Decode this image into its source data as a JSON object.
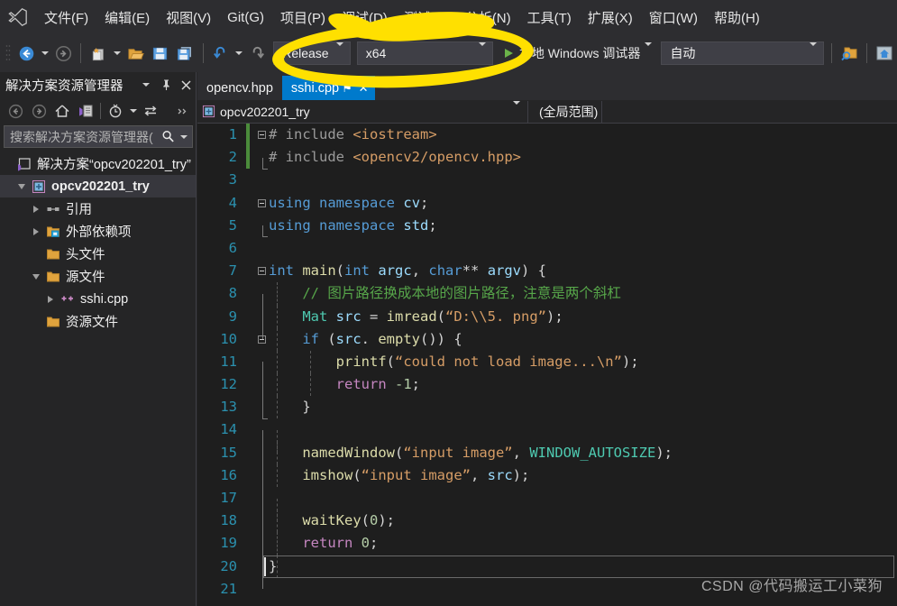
{
  "app": {
    "logo_icon": "visual-studio-logo-icon"
  },
  "menubar": {
    "items": [
      {
        "label": "文件(F)"
      },
      {
        "label": "编辑(E)"
      },
      {
        "label": "视图(V)"
      },
      {
        "label": "Git(G)"
      },
      {
        "label": "项目(P)"
      },
      {
        "label": "调试(D)"
      },
      {
        "label": "测试(S)"
      },
      {
        "label": "分析(N)"
      },
      {
        "label": "工具(T)"
      },
      {
        "label": "扩展(X)"
      },
      {
        "label": "窗口(W)"
      },
      {
        "label": "帮助(H)"
      }
    ]
  },
  "toolbar": {
    "back_icon": "navigate-back-icon",
    "forward_icon": "navigate-forward-icon",
    "new_item_icon": "new-item-icon",
    "open_file_icon": "open-file-icon",
    "save_icon": "save-icon",
    "save_all_icon": "save-all-icon",
    "undo_icon": "undo-icon",
    "redo_icon": "redo-icon",
    "configuration": "Release",
    "platform": "x64",
    "debug_target": "本地 Windows 调试器",
    "debug_target_icon": "run-play-icon",
    "auto_select": "自动",
    "find_in_files_icon": "find-in-files-icon",
    "home_icon": "home-window-icon"
  },
  "solution_explorer": {
    "title": "解决方案资源管理器",
    "menu_icon": "chevron-down-icon",
    "pin_icon": "pin-icon",
    "close_icon": "close-icon",
    "toolbar_icons": [
      "back-icon",
      "forward-icon",
      "home-icon",
      "switch-views-icon",
      "pending-changes-icon",
      "sync-with-active-document-icon",
      "expand-overflow-icon"
    ],
    "search": {
      "placeholder": "搜索解决方案资源管理器(",
      "value": "",
      "search_icon": "search-icon",
      "dropdown_icon": "chevron-down-icon"
    },
    "tree": [
      {
        "label": "解决方案“opcv202201_try”",
        "icon": "solution-icon",
        "depth": 0,
        "expander": "none",
        "bold": false,
        "selected": false
      },
      {
        "label": "opcv202201_try",
        "icon": "cpp-project-icon",
        "depth": 1,
        "expander": "down",
        "bold": true,
        "selected": true
      },
      {
        "label": "引用",
        "icon": "references-icon",
        "depth": 2,
        "expander": "right",
        "bold": false,
        "selected": false
      },
      {
        "label": "外部依赖项",
        "icon": "external-dependencies-icon",
        "depth": 2,
        "expander": "right",
        "bold": false,
        "selected": false
      },
      {
        "label": "头文件",
        "icon": "folder-filter-icon",
        "depth": 2,
        "expander": "none",
        "bold": false,
        "selected": false
      },
      {
        "label": "源文件",
        "icon": "folder-filter-icon",
        "depth": 2,
        "expander": "down",
        "bold": false,
        "selected": false
      },
      {
        "label": "sshi.cpp",
        "icon": "cpp-file-icon",
        "depth": 3,
        "expander": "right",
        "bold": false,
        "selected": false
      },
      {
        "label": "资源文件",
        "icon": "folder-filter-icon",
        "depth": 2,
        "expander": "none",
        "bold": false,
        "selected": false
      }
    ]
  },
  "editor": {
    "tabs": [
      {
        "label": "opencv.hpp",
        "active": false,
        "pin_icon": "",
        "close_icon": ""
      },
      {
        "label": "sshi.cpp",
        "active": true,
        "pin_icon": "⚑",
        "close_icon": "✕"
      }
    ],
    "navbar": {
      "scope_project": "opcv202201_try",
      "scope_project_icon": "cpp-project-icon",
      "scope_dropdown_icon": "chevron-down-icon",
      "member": "(全局范围)"
    },
    "lines": [
      {
        "num": "1",
        "change": true,
        "fold": "open",
        "text": "# include <iostream>"
      },
      {
        "num": "2",
        "change": true,
        "fold": "end",
        "text": "# include <opencv2/opencv.hpp>"
      },
      {
        "num": "3",
        "change": false,
        "fold": "none",
        "text": ""
      },
      {
        "num": "4",
        "change": false,
        "fold": "open",
        "text": "using namespace cv;"
      },
      {
        "num": "5",
        "change": false,
        "fold": "end",
        "text": "using namespace std;"
      },
      {
        "num": "6",
        "change": false,
        "fold": "none",
        "text": ""
      },
      {
        "num": "7",
        "change": false,
        "fold": "open",
        "text": "int main(int argc, char** argv) {"
      },
      {
        "num": "8",
        "change": false,
        "fold": "line",
        "text": "    // 图片路径换成本地的图片路径，注意是两个斜杠"
      },
      {
        "num": "9",
        "change": false,
        "fold": "line",
        "text": "    Mat src = imread(\"D:\\\\5. png\");"
      },
      {
        "num": "10",
        "change": false,
        "fold": "open2",
        "text": "    if (src. empty()) {"
      },
      {
        "num": "11",
        "change": false,
        "fold": "line",
        "text": "        printf(\"could not load image...\\n\");"
      },
      {
        "num": "12",
        "change": false,
        "fold": "line",
        "text": "        return -1;"
      },
      {
        "num": "13",
        "change": false,
        "fold": "end2",
        "text": "    }"
      },
      {
        "num": "14",
        "change": false,
        "fold": "line",
        "text": ""
      },
      {
        "num": "15",
        "change": false,
        "fold": "line",
        "text": "    namedWindow(\"input image\", WINDOW_AUTOSIZE);"
      },
      {
        "num": "16",
        "change": false,
        "fold": "line",
        "text": "    imshow(\"input image\", src);"
      },
      {
        "num": "17",
        "change": false,
        "fold": "line",
        "text": ""
      },
      {
        "num": "18",
        "change": false,
        "fold": "line",
        "text": "    waitKey(0);"
      },
      {
        "num": "19",
        "change": false,
        "fold": "line",
        "text": "    return 0;"
      },
      {
        "num": "20",
        "change": false,
        "fold": "endm",
        "text": "}"
      },
      {
        "num": "21",
        "change": false,
        "fold": "none",
        "text": ""
      }
    ]
  },
  "annotation": {
    "shape": "hand-drawn-ellipse-highlight",
    "color": "#ffe000"
  },
  "watermark": {
    "text": "CSDN @代码搬运工小菜狗"
  },
  "colors": {
    "accent": "#007acc",
    "chrome": "#2d2d30",
    "panel": "#252526",
    "editor_bg": "#1e1e1e",
    "highlight_yellow": "#ffe000"
  }
}
